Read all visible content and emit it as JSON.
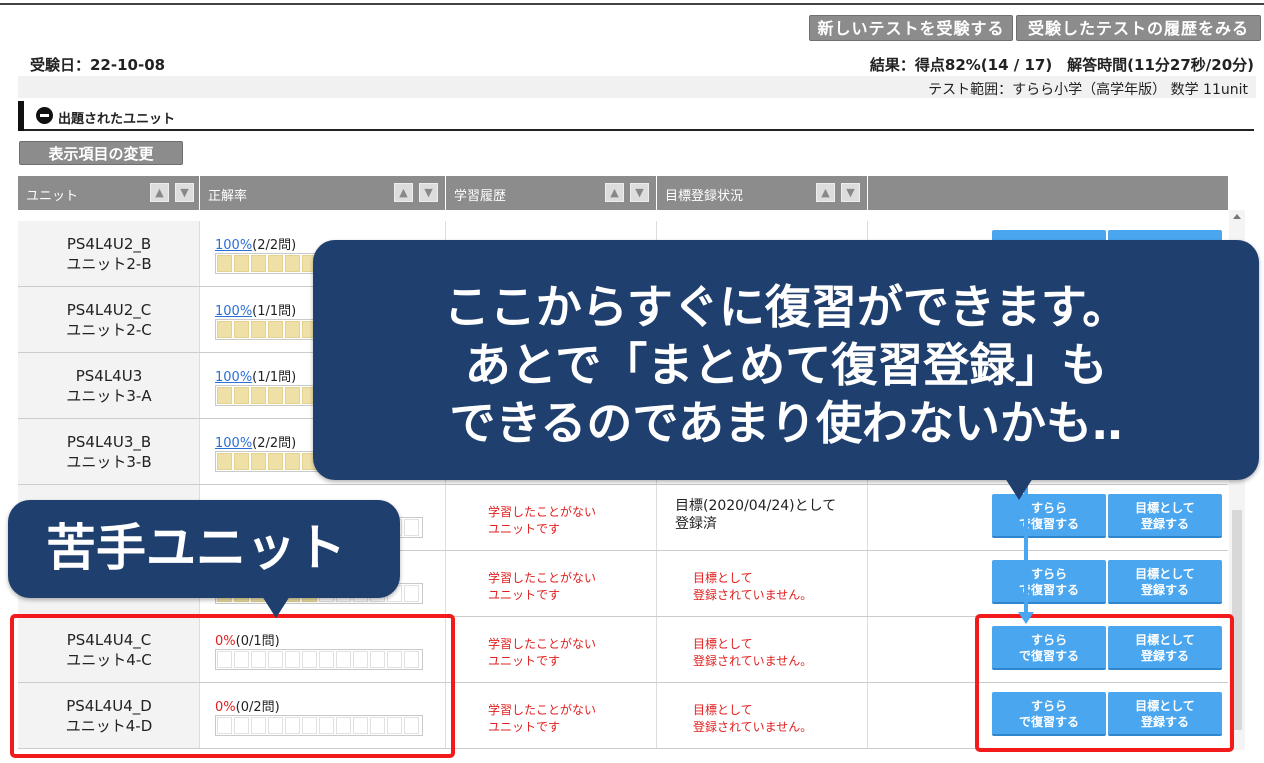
{
  "header": {
    "new_test_button": "新しいテストを受験する",
    "history_button": "受験したテストの履歴をみる",
    "exam_date": "受験日：22-10-08",
    "result": "結果：得点82%(14 / 17)　解答時間(11分27秒/20分)",
    "test_range": "テスト範囲：すらら小学（高学年版） 数学 11unit"
  },
  "section": {
    "title": "出題されたユニット",
    "display_button": "表示項目の変更"
  },
  "table": {
    "columns": [
      {
        "label": "ユニット"
      },
      {
        "label": "正解率"
      },
      {
        "label": "学習履歴"
      },
      {
        "label": "目標登録状況"
      }
    ],
    "sort_up": "▲",
    "sort_down": "▼",
    "rows": [
      {
        "code": "PS4L4U2_B",
        "name": "ユニット2-B",
        "pct": "100%",
        "count": "(2/2問)",
        "filled": 1.0,
        "hist": "",
        "goal": "",
        "b1": "",
        "b2": ""
      },
      {
        "code": "PS4L4U2_C",
        "name": "ユニット2-C",
        "pct": "100%",
        "count": "(1/1問)",
        "filled": 1.0,
        "hist": "",
        "goal": "",
        "b1": "",
        "b2": ""
      },
      {
        "code": "PS4L4U3",
        "name": "ユニット3-A",
        "pct": "100%",
        "count": "(1/1問)",
        "filled": 1.0,
        "hist": "",
        "goal": "",
        "b1": "",
        "b2": ""
      },
      {
        "code": "PS4L4U3_B",
        "name": "ユニット3-B",
        "pct": "100%",
        "count": "(2/2問)",
        "filled": 1.0,
        "hist": "",
        "goal": "",
        "b1": "",
        "b2": ""
      },
      {
        "code": "",
        "name": "",
        "pct": "",
        "count": "",
        "filled": 0.5,
        "hist": "学習したことがない\nユニットです",
        "goal": "目標(2020/04/24)として\n登録済",
        "goal_done": true,
        "b1": "すらら\nで復習する",
        "b2": "目標として\n登録する"
      },
      {
        "code": "",
        "name": "",
        "pct": "",
        "count": "",
        "filled": 0.5,
        "hist": "学習したことがない\nユニットです",
        "goal": "目標として\n登録されていません。",
        "b1": "すらら\nで復習する",
        "b2": "目標として\n登録する"
      },
      {
        "code": "PS4L4U4_C",
        "name": "ユニット4-C",
        "pct": "0%",
        "count": "(0/1問)",
        "filled": 0,
        "hist": "学習したことがない\nユニットです",
        "goal": "目標として\n登録されていません。",
        "b1": "すらら\nで復習する",
        "b2": "目標として\n登録する"
      },
      {
        "code": "PS4L4U4_D",
        "name": "ユニット4-D",
        "pct": "0%",
        "count": "(0/2問)",
        "filled": 0,
        "hist": "学習したことがない\nユニットです",
        "goal": "目標として\n登録されていません。",
        "b1": "すらら\nで復習する",
        "b2": "目標として\n登録する"
      }
    ]
  },
  "callouts": {
    "big": "ここからすぐに復習ができます。\nあとで「まとめて復習登録」も\nできるのであまり使わないかも‥",
    "small": "苦手ユニット"
  },
  "colors": {
    "callout_bg": "#1f3f6f",
    "highlight": "#f21a1a",
    "button_blue": "#4aa6ef",
    "zero_red": "#e02020"
  }
}
